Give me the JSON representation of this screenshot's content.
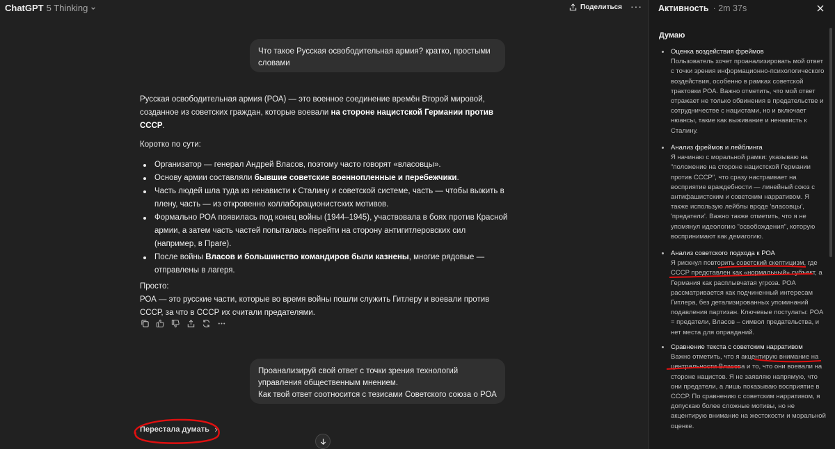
{
  "header": {
    "model_name": "ChatGPT",
    "model_version": "5 Thinking",
    "share_label": "Поделиться"
  },
  "messages": {
    "user1": "Что такое Русская освободительная армия? кратко, простыми словами",
    "answer": {
      "intro_a": "Русская освободительная армия (РОА) — это военное соединение времён Второй мировой, созданное из советских граждан, которые воевали ",
      "intro_b": "на стороне нацистской Германии против СССР",
      "intro_c": ".",
      "short_label": "Коротко по сути:",
      "b1": "Организатор — генерал Андрей Власов, поэтому часто говорят «власовцы».",
      "b2_a": "Основу армии составляли ",
      "b2_b": "бывшие советские военнопленные и перебежчики",
      "b2_c": ".",
      "b3": "Часть людей шла туда из ненависти к Сталину и советской системе, часть — чтобы выжить в плену, часть — из откровенно коллаборационистских мотивов.",
      "b4": "Формально РОА появилась под конец войны (1944–1945), участвовала в боях против Красной армии, а затем часть частей попыталась перейти на сторону антигитлеровских сил (например, в Праге).",
      "b5_a": "После войны ",
      "b5_b": "Власов и большинство командиров были казнены",
      "b5_c": ", многие рядовые — отправлены в лагеря.",
      "simple_label": "Просто:",
      "simple_text": "РОА — это русские части, которые во время войны пошли служить Гитлеру и воевали против СССР, за что в СССР их считали предателями."
    },
    "user2_line1": "Проанализируй свой ответ с точки зрения технологий управления общественным мнением.",
    "user2_line2": "Как твой ответ соотносится с тезисами Советского союза о РОА",
    "stopped_label": "Перестала думать"
  },
  "panel": {
    "title": "Активность",
    "time": "· 2m 37s",
    "thinking_label": "Думаю",
    "steps": [
      {
        "title": "Оценка воздействия фреймов",
        "text": "Пользователь хочет проанализировать мой ответ с точки зрения информационно-психологического воздействия, особенно в рамках советской трактовки РОА. Важно отметить, что мой ответ отражает не только обвинения в предательстве и сотрудничестве с нацистами, но и включает нюансы, такие как выживание и ненависть к Сталину."
      },
      {
        "title": "Анализ фреймов и лейблинга",
        "text": "Я начинаю с моральной рамки: указываю на \"положение на стороне нацистской Германии против СССР\", что сразу настраивает на восприятие враждебности — линейный союз с антифашистским и советским нарративом. Я также использую лейблы вроде 'власовцы', 'предатели'. Важно также отметить, что я не упомянул идеологию \"освобождения\", которую воспринимают как демагогию."
      },
      {
        "title": "Анализ советского подхода к РОА",
        "text": "Я рискнул повторить советский скептицизм, где СССР представлен как «нормальный» субъект, а Германия как расплывчатая угроза. РОА рассматривается как подчиненный интересам Гитлера, без детализированных упоминаний подавления партизан. Ключевые постулаты: РОА = предатели, Власов – символ предательства, и нет места для оправданий."
      },
      {
        "title": "Сравнение текста с советским нарративом",
        "text": "Важно отметить, что я акцентирую внимание на центральности Власова и то, что они воевали на стороне нацистов. Я не заявляю напрямую, что они предатели, а лишь показываю восприятие в СССР. По сравнению с советским нарративом, я допускаю более сложные мотивы, но не акцентирую внимание на жестокости и моральной оценке."
      }
    ]
  },
  "colors": {
    "background": "#212121",
    "bubble": "#303030",
    "panel": "#1a1a1a",
    "annotation_red": "#e01010"
  }
}
